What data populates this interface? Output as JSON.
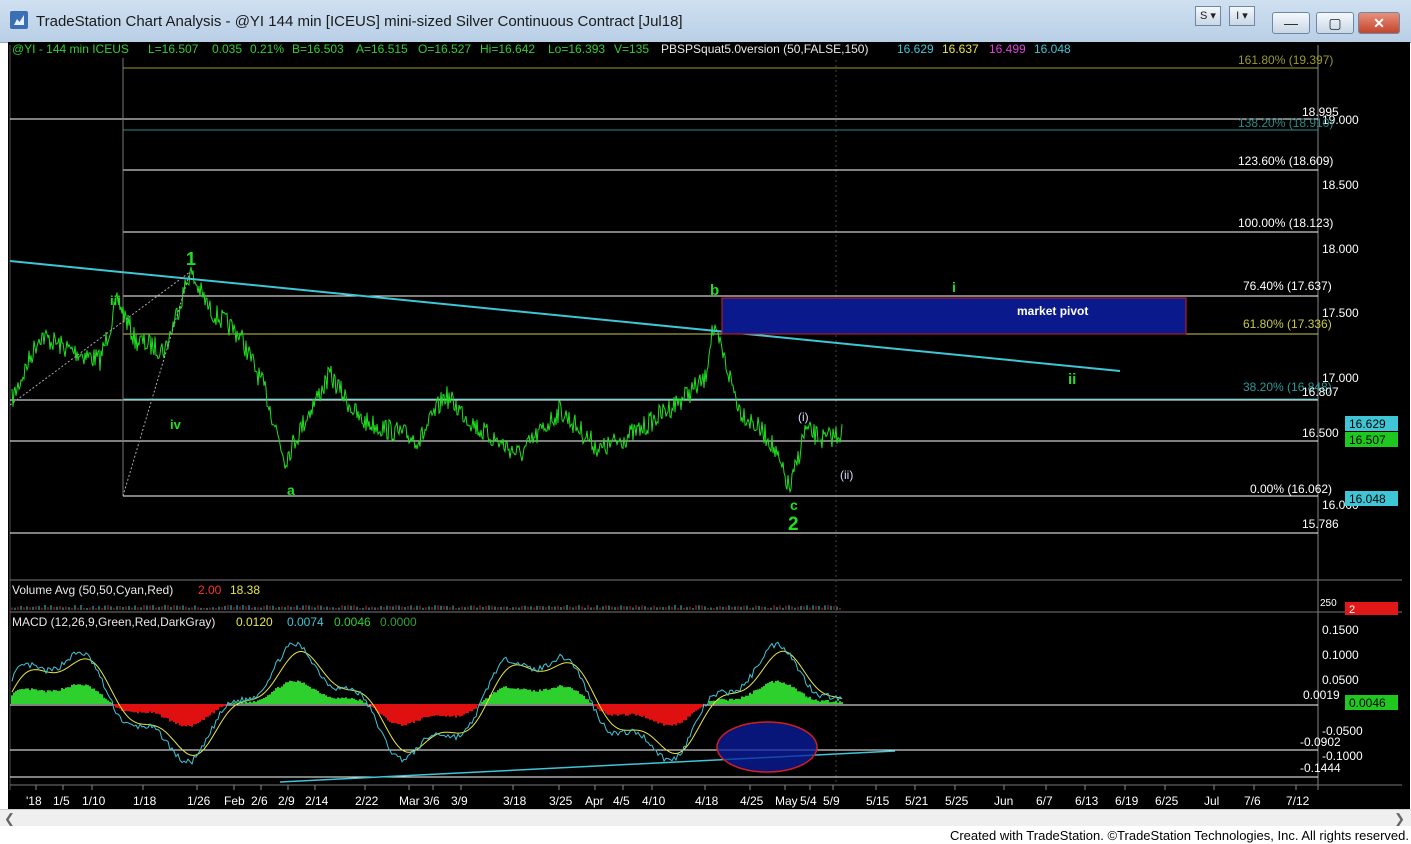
{
  "window": {
    "title": "TradeStation Chart Analysis - @YI 144 min [ICEUS] mini-sized Silver Continuous Contract [Jul18]",
    "s_btn": "S",
    "i_btn": "I",
    "min_btn": "—",
    "max_btn": "▢",
    "close_btn": "✕"
  },
  "header": {
    "symbol": "@YI - 144 min  ICEUS",
    "last": "L=16.507",
    "change": "0.035",
    "pct": "0.21%",
    "bid": "B=16.503",
    "ask": "A=16.515",
    "open": "O=16.527",
    "high": "Hi=16.642",
    "low": "Lo=16.393",
    "volume": "V=135",
    "study": "PBSPSquat5.0version (50,FALSE,150)",
    "s1": "16.629",
    "s2": "16.637",
    "s3": "16.499",
    "s4": "16.048"
  },
  "volume_header": {
    "label": "Volume Avg (50,50,Cyan,Red)",
    "v1": "2.00",
    "v2": "18.38"
  },
  "macd_header": {
    "label": "MACD (12,26,9,Green,Red,DarkGray)",
    "v1": "0.0120",
    "v2": "0.0074",
    "v3": "0.0046",
    "v4": "0.0000"
  },
  "price_axis": [
    "19.000",
    "18.500",
    "18.000",
    "17.500",
    "17.000"
  ],
  "price_axis_low": "16.000",
  "macd_axis": [
    "0.1500",
    "0.1000",
    "0.0500",
    "-0.0500",
    "-0.1000"
  ],
  "fib_levels": [
    {
      "label": "161.80% (19.397)",
      "color": "#9a9a2a"
    },
    {
      "label": "138.20% (18.910)",
      "color": "#2a8a8a"
    },
    {
      "label": "123.60% (18.609)",
      "color": "#ffffff"
    },
    {
      "label": "100.00% (18.123)",
      "color": "#ffffff"
    },
    {
      "label": "76.40% (17.637)",
      "color": "#ffffff"
    },
    {
      "label": "61.80% (17.336)",
      "color": "#c8c84a"
    },
    {
      "label": "38.20% (16.848)",
      "color": "#2a9a9a"
    },
    {
      "label": "0.00% (16.062)",
      "color": "#ffffff"
    }
  ],
  "level_labels": {
    "l18995": "18.995",
    "l16807": "16.807",
    "l16500": "16.500",
    "l15786": "15.786",
    "macd_a": "0.0019",
    "macd_b": "-0.0902",
    "macd_c": "-0.1444"
  },
  "price_tags": {
    "t1": "16.629",
    "t2": "16.507",
    "t3": "16.048",
    "vol_tag": "2",
    "vol_axis": "250",
    "macd_tag": "0.0046"
  },
  "zone_label": "market pivot",
  "wave_labels": {
    "w1": "1",
    "iii": "iii",
    "iv": "iv",
    "a": "a",
    "b": "b",
    "c": "c",
    "w2": "2",
    "i": "i",
    "ii": "ii",
    "pi": "(i)",
    "pii": "(ii)"
  },
  "dates": [
    "'18",
    "1/5",
    "1/10",
    "1/18",
    "1/26",
    "Feb",
    "2/6",
    "2/9",
    "2/14",
    "2/22",
    "Mar",
    "3/6",
    "3/9",
    "3/18",
    "3/25",
    "Apr",
    "4/5",
    "4/10",
    "4/18",
    "4/25",
    "May",
    "5/4",
    "5/9",
    "5/15",
    "5/21",
    "5/25",
    "Jun",
    "6/7",
    "6/13",
    "6/19",
    "6/25",
    "Jul",
    "7/6",
    "7/12"
  ],
  "credit": "Created with TradeStation. ©TradeStation Technologies, Inc. All rights reserved.",
  "colors": {
    "price": "#1ee01e",
    "trendline": "#3ec6d6",
    "zone": "#0a1a8c",
    "zone_border": "#d02020",
    "macd_pos": "#2dd02d",
    "macd_neg": "#e01010",
    "wave_green": "#22dd22",
    "wave_white": "#d8d8ff"
  }
}
